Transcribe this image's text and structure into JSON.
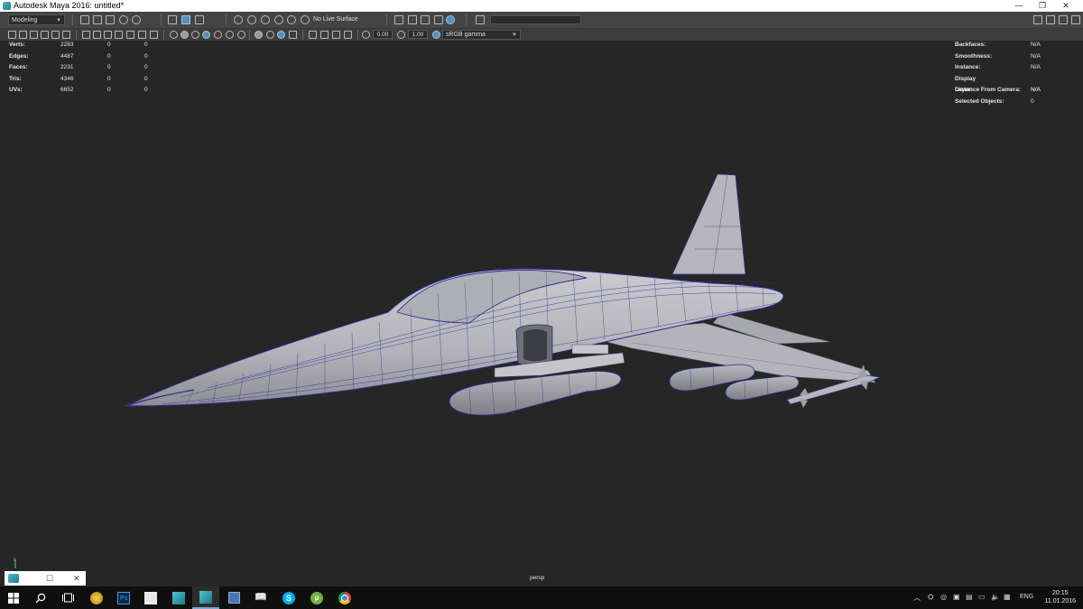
{
  "window": {
    "title": "Autodesk Maya 2016: untitled*",
    "controls": [
      "—",
      "❐",
      "✕"
    ]
  },
  "statusline": {
    "mode": "Modeling",
    "live_surface": "No Live Surface"
  },
  "shelf": {
    "exposure": "0.00",
    "gamma": "1.00",
    "color_space": "sRGB gamma"
  },
  "hud": {
    "left": [
      {
        "label": "Verts:",
        "v1": "2283",
        "v2": "0",
        "v3": "0"
      },
      {
        "label": "Edges:",
        "v1": "4487",
        "v2": "0",
        "v3": "0"
      },
      {
        "label": "Faces:",
        "v1": "2231",
        "v2": "0",
        "v3": "0"
      },
      {
        "label": "Tris:",
        "v1": "4346",
        "v2": "0",
        "v3": "0"
      },
      {
        "label": "UVs:",
        "v1": "6652",
        "v2": "0",
        "v3": "0"
      }
    ],
    "right": [
      {
        "label": "Backfaces:",
        "value": "N/A"
      },
      {
        "label": "Smoothness:",
        "value": "N/A"
      },
      {
        "label": "Instance:",
        "value": "N/A"
      },
      {
        "label": "Display Layer:",
        "value": "N/A"
      },
      {
        "label": "Distance From Camera:",
        "value": "N/A"
      },
      {
        "label": "Selected Objects:",
        "value": "0"
      }
    ]
  },
  "viewport": {
    "camera": "persp",
    "axis_label": "y"
  },
  "taskbar": {
    "apps": [
      "start",
      "search",
      "task-view",
      "app-generic",
      "photoshop",
      "app-generic-2",
      "maya-1",
      "maya-2",
      "save",
      "reader",
      "skype",
      "utorrent",
      "chrome"
    ],
    "language": "ENG",
    "time": "20:15",
    "date": "11.01.2016"
  }
}
